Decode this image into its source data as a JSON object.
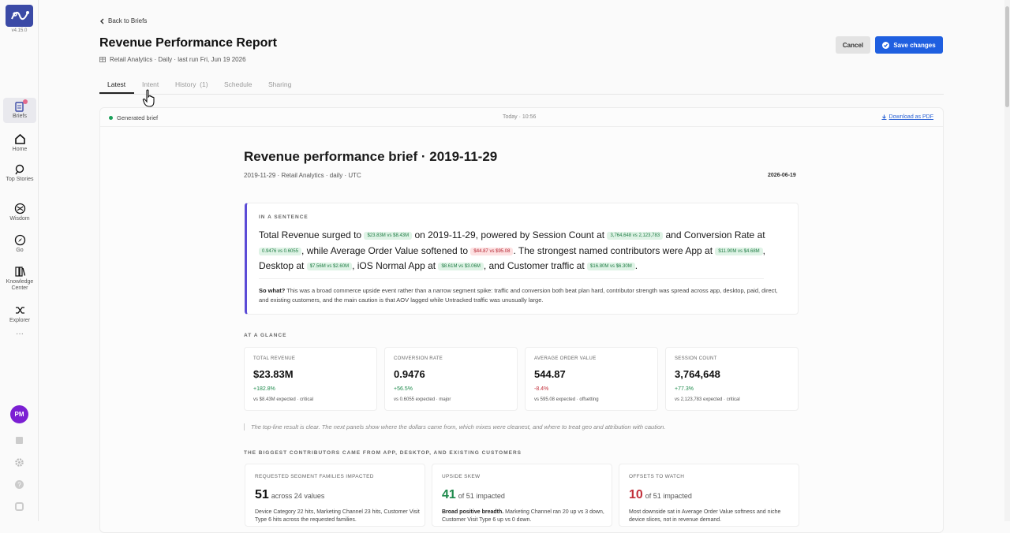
{
  "app": {
    "version": "v4.15.0",
    "logo": "brand-logo"
  },
  "nav": [
    {
      "label": "Briefs",
      "icon": "briefs-icon",
      "active": true,
      "badge": true
    },
    {
      "label": "Home",
      "icon": "home-icon"
    },
    {
      "label": "Top Stories",
      "icon": "top-stories-icon"
    },
    {
      "label": "Wisdom",
      "icon": "wisdom-icon"
    },
    {
      "label": "Go",
      "icon": "go-icon"
    },
    {
      "label": "Knowledge Center",
      "icon": "knowledge-center-icon"
    },
    {
      "label": "Explorer",
      "icon": "explorer-icon"
    }
  ],
  "user": {
    "initials": "PM"
  },
  "header": {
    "back_label": "Back to Briefs",
    "title": "Revenue Performance Report",
    "subtitle": "Retail Analytics · Daily · last run Fri, Jun 19 2026",
    "cancel_label": "Cancel",
    "save_label": "Save changes"
  },
  "tabs": [
    {
      "label": "Latest",
      "active": true
    },
    {
      "label": "Intent"
    },
    {
      "label": "History  (1)"
    },
    {
      "label": "Schedule"
    },
    {
      "label": "Sharing"
    }
  ],
  "panel": {
    "status": "Generated brief",
    "time": "Today · 10:56",
    "download_label": "Download as PDF"
  },
  "brief": {
    "title": "Revenue performance brief · 2019-11-29",
    "meta": "2019-11-29 · Retail Analytics · daily · UTC",
    "date": "2026-06-19",
    "sentence_label": "IN A SENTENCE",
    "sentence": {
      "t1": "Total Revenue surged to",
      "p1": "$23.83M vs $8.43M",
      "t2": "on 2019-11-29, powered by Session Count at",
      "p2": "3,764,648 vs 2,123,783",
      "t3": "and Conversion Rate at",
      "p3": "0.9476 vs 0.6055",
      "t4": ", while Average Order Value softened to",
      "p4": "$44.87 vs $95.08",
      "t5": ". The strongest named contributors were App at",
      "p5": "$11.90M vs $4.68M",
      "t6": ", Desktop at",
      "p6": "$7.56M vs $2.60M",
      "t7": ", iOS Normal App at",
      "p7": "$8.61M vs $3.06M",
      "t8": ", and Customer traffic at",
      "p8": "$16.80M vs $6.30M",
      "t9": "."
    },
    "so_what_label": "So what?",
    "so_what": "This was a broad commerce upside event rather than a narrow segment spike: traffic and conversion both beat plan hard, contributor strength was spread across app, desktop, paid, direct, and existing customers, and the main caution is that AOV lagged while Untracked traffic was unusually large.",
    "glance_label": "AT A GLANCE",
    "kpis": [
      {
        "label": "TOTAL REVENUE",
        "value": "$23.83M",
        "delta": "+182.8%",
        "dir": "up",
        "note": "vs $8.43M expected · critical"
      },
      {
        "label": "CONVERSION RATE",
        "value": "0.9476",
        "delta": "+56.5%",
        "dir": "up",
        "note": "vs 0.6055 expected · major"
      },
      {
        "label": "AVERAGE ORDER VALUE",
        "value": "544.87",
        "delta": "-8.4%",
        "dir": "down",
        "note": "vs 595.08 expected · offsetting"
      },
      {
        "label": "SESSION COUNT",
        "value": "3,764,648",
        "delta": "+77.3%",
        "dir": "up",
        "note": "vs 2,123,783 expected · critical"
      }
    ],
    "note": "The top-line result is clear. The next panels show where the dollars came from, which mixes were cleanest, and where to treat geo and attribution with caution.",
    "contrib_label": "THE BIGGEST CONTRIBUTORS CAME FROM APP, DESKTOP, AND EXISTING CUSTOMERS",
    "cards": [
      {
        "label": "REQUESTED SEGMENT FAMILIES IMPACTED",
        "big": "51",
        "sub": "across 24 values",
        "tone": "neutral",
        "bold": "",
        "body": "Device Category 22 hits, Marketing Channel 23 hits, Customer Visit Type 6 hits across the requested families."
      },
      {
        "label": "UPSIDE SKEW",
        "big": "41",
        "sub": "of 51 impacted",
        "tone": "up",
        "bold": "Broad positive breadth.",
        "body": " Marketing Channel ran 20 up vs 3 down, Customer Visit Type 6 up vs 0 down."
      },
      {
        "label": "OFFSETS TO WATCH",
        "big": "10",
        "sub": "of 51 impacted",
        "tone": "down",
        "bold": "",
        "body": "Most downside sat in Average Order Value softness and niche device slices, not in revenue demand."
      }
    ]
  }
}
